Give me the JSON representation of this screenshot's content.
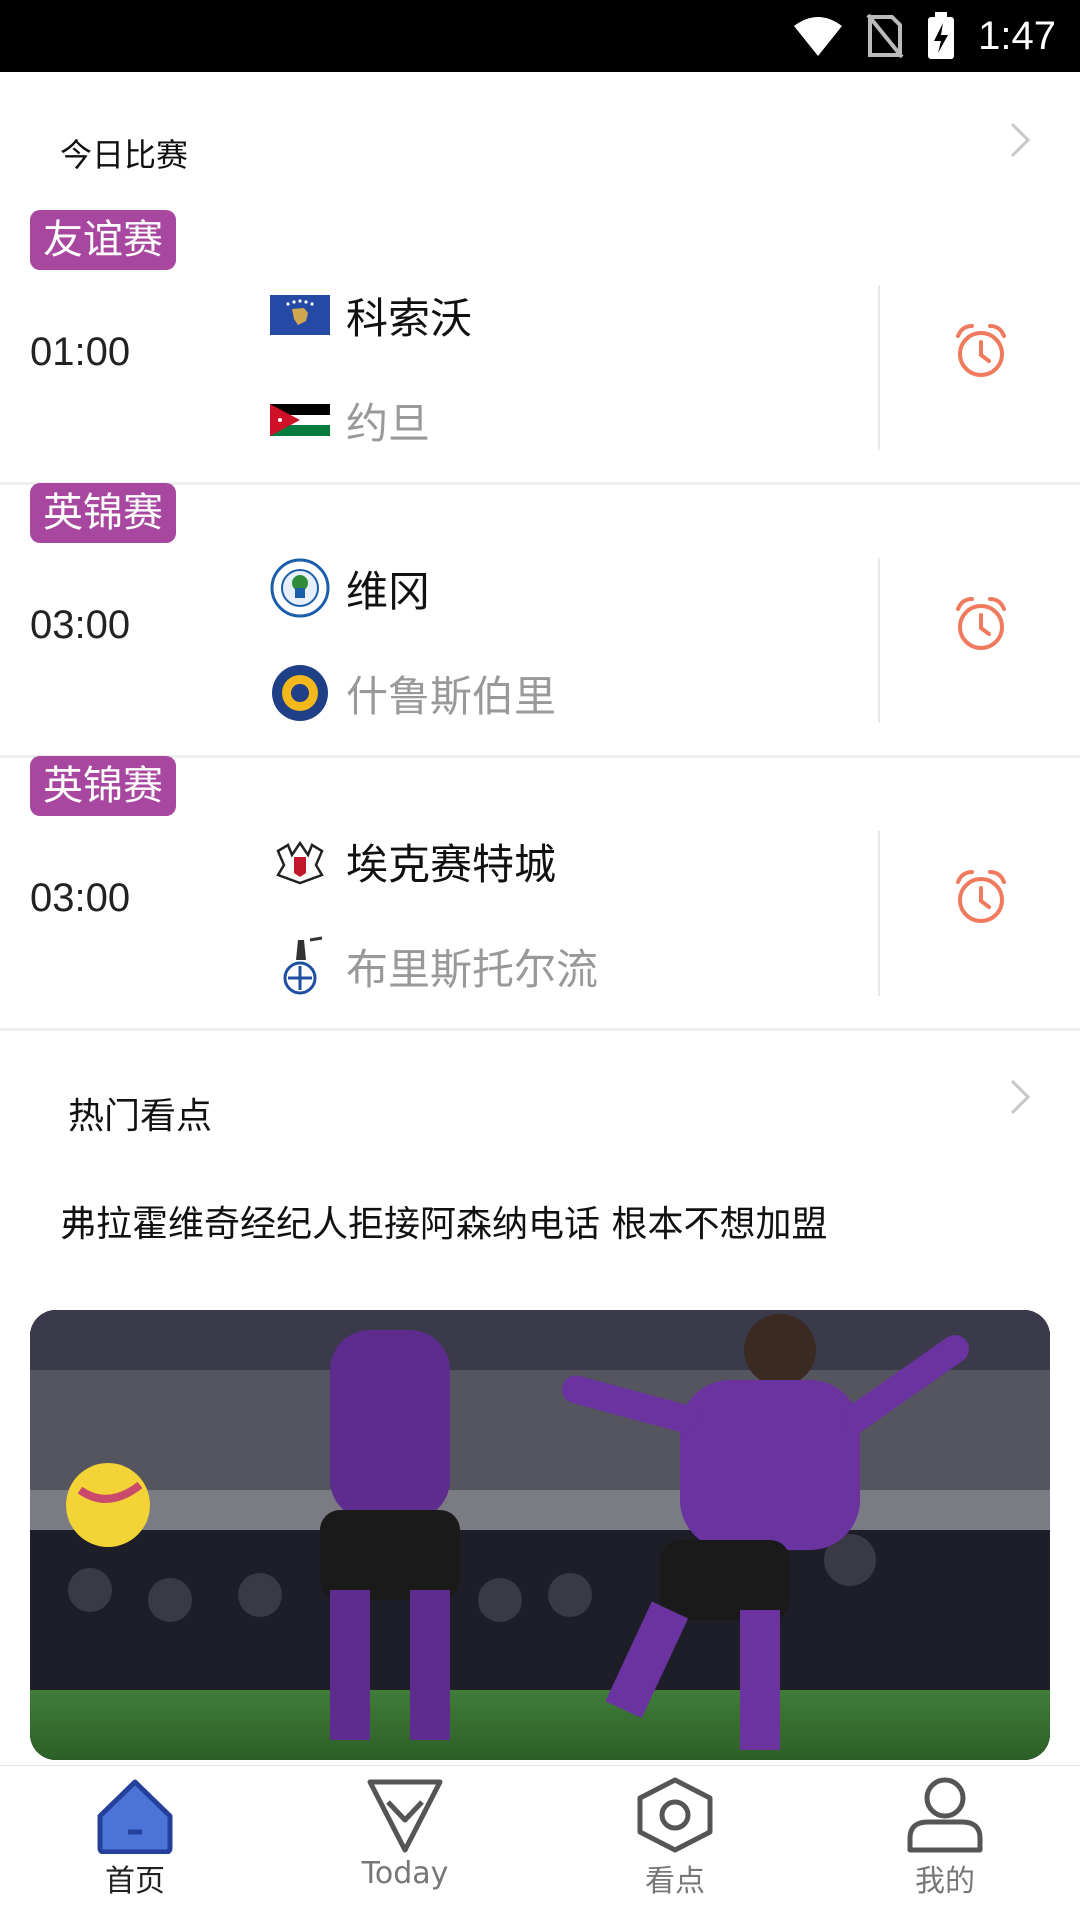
{
  "status_bar": {
    "time": "1:47"
  },
  "today_matches": {
    "title": "今日比赛",
    "matches": [
      {
        "competition": "友谊赛",
        "time": "01:00",
        "home": "科索沃",
        "away": "约旦"
      },
      {
        "competition": "英锦赛",
        "time": "03:00",
        "home": "维冈",
        "away": "什鲁斯伯里"
      },
      {
        "competition": "英锦赛",
        "time": "03:00",
        "home": "埃克赛特城",
        "away": "布里斯托尔流"
      }
    ]
  },
  "hot_topics": {
    "title": "热门看点",
    "headline": "弗拉霍维奇经纪人拒接阿森纳电话 根本不想加盟"
  },
  "bottom_nav": {
    "items": [
      {
        "label": "首页"
      },
      {
        "label": "Today"
      },
      {
        "label": "看点"
      },
      {
        "label": "我的"
      }
    ]
  },
  "colors": {
    "badge": "#a8479f",
    "alarm": "#f07a5e",
    "nav_active": "#3b5fc6"
  }
}
